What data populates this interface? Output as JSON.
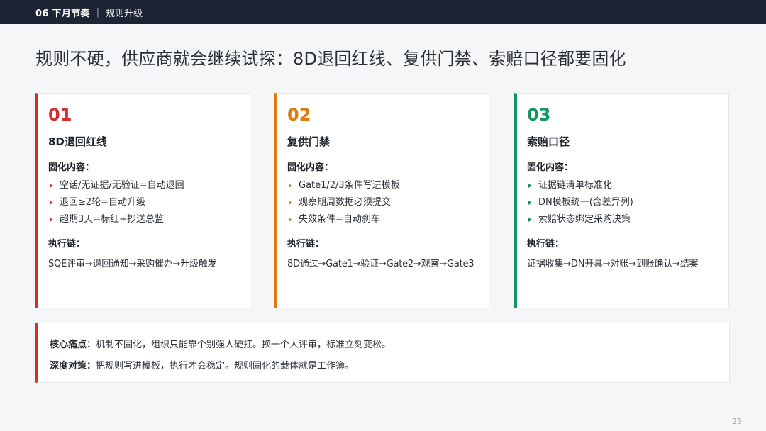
{
  "header": {
    "section": "06 下月节奏",
    "separator": "|",
    "subtitle": "规则升级"
  },
  "title": "规则不硬，供应商就会继续试探：8D退回红线、复供门禁、索赔口径都要固化",
  "cards": [
    {
      "number": "01",
      "title": "8D退回红线",
      "content_label": "固化内容：",
      "points": [
        "空话/无证据/无验证=自动退回",
        "退回≥2轮=自动升级",
        "超期3天=标红+抄送总监"
      ],
      "chain_label": "执行链：",
      "chain": "SQE评审→退回通知→采购催办→升级触发",
      "accent": "#d32f2f"
    },
    {
      "number": "02",
      "title": "复供门禁",
      "content_label": "固化内容：",
      "points": [
        "Gate1/2/3条件写进模板",
        "观察期周数据必须提交",
        "失效条件=自动刹车"
      ],
      "chain_label": "执行链：",
      "chain": "8D通过→Gate1→验证→Gate2→观察→Gate3",
      "accent": "#e07b0a"
    },
    {
      "number": "03",
      "title": "索赔口径",
      "content_label": "固化内容：",
      "points": [
        "证据链清单标准化",
        "DN模板统一(含差异列)",
        "索赔状态绑定采购决策"
      ],
      "chain_label": "执行链：",
      "chain": "证据收集→DN开具→对账→到账确认→结案",
      "accent": "#14955f"
    }
  ],
  "summary": {
    "pain_label": "核心痛点：",
    "pain_text": "机制不固化，组织只能靠个别强人硬扛。换一个人评审，标准立刻变松。",
    "strategy_label": "深度对策：",
    "strategy_text": "把规则写进模板，执行才会稳定。规则固化的载体就是工作簿。"
  },
  "page_number": "25"
}
